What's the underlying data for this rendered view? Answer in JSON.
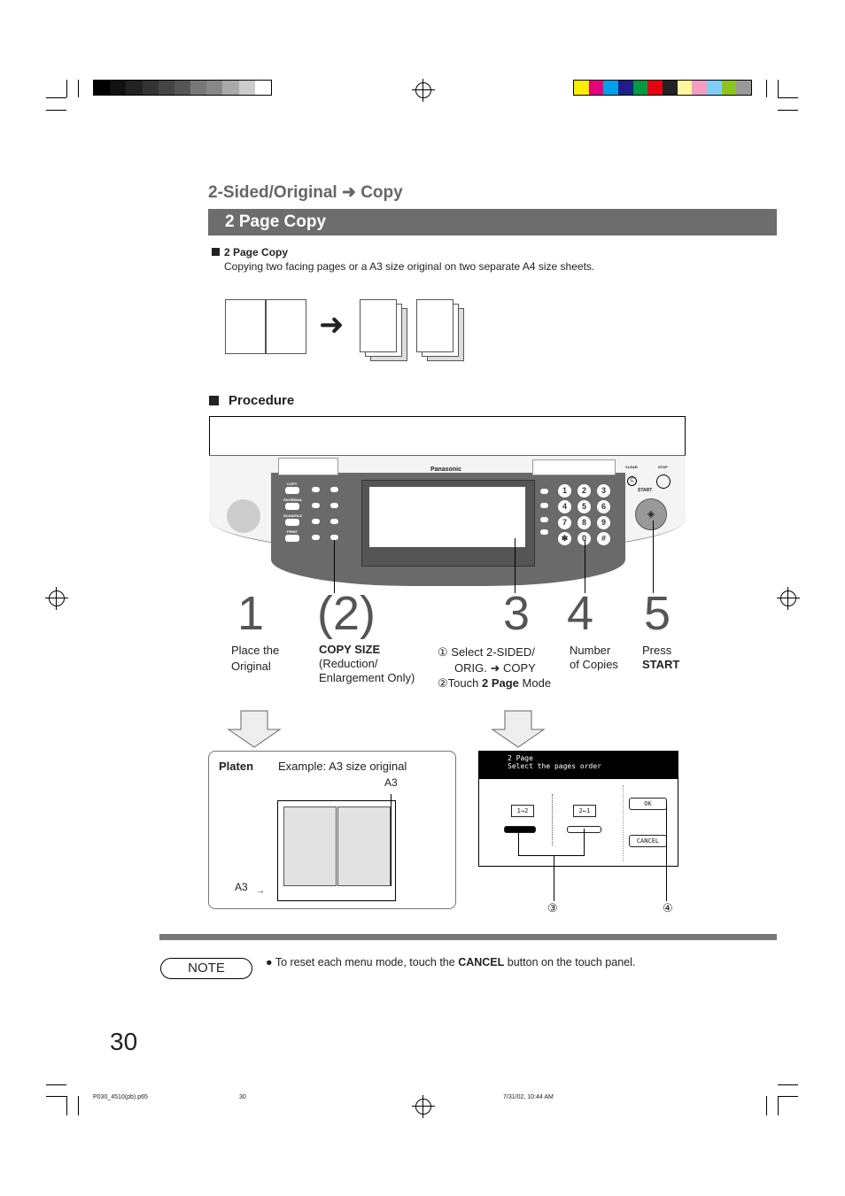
{
  "header": {
    "section_title": "2-Sided/Original",
    "arrow": "➜",
    "section_target": "Copy",
    "banner": "2 Page Copy"
  },
  "intro": {
    "heading": "2 Page Copy",
    "text": "Copying two facing pages or a A3 size original on two separate A4 size sheets."
  },
  "procedure": {
    "heading": "Procedure",
    "panel": {
      "brand": "Panasonic",
      "clear": "CLEAR",
      "stop": "STOP",
      "start": "START",
      "modes": [
        "COPY",
        "FAX/EMAIL",
        "SCAN/FILE",
        "PRINT"
      ],
      "keys": [
        "1",
        "2",
        "3",
        "4",
        "5",
        "6",
        "7",
        "8",
        "9",
        "✱",
        "0",
        "#"
      ]
    },
    "steps": [
      {
        "number": "1",
        "lines": [
          "Place the",
          "Original"
        ]
      },
      {
        "number": "(2)",
        "bold": "COPY SIZE",
        "lines": [
          "(Reduction/",
          "Enlargement Only)"
        ]
      },
      {
        "number": "3",
        "l1_prefix": "①",
        "l1": "Select 2-SIDED/",
        "l2a": "ORIG.",
        "l2b": "COPY",
        "l3_prefix": "②Touch",
        "l3_bold": "2 Page",
        "l3_suffix": "Mode"
      },
      {
        "number": "4",
        "lines": [
          "Number",
          "of Copies"
        ]
      },
      {
        "number": "5",
        "lines": [
          "Press"
        ],
        "bold": "START"
      }
    ]
  },
  "platen": {
    "title": "Platen",
    "example": "Example: A3 size original",
    "a3_top": "A3",
    "a3_left": "A3"
  },
  "touch_screen": {
    "line1": "2 Page",
    "line2": "Select the pages order",
    "opt1": "1→2",
    "opt2": "2←1",
    "ok": "OK",
    "cancel": "CANCEL",
    "callout3": "③",
    "callout4": "④"
  },
  "note": {
    "label": "NOTE",
    "prefix": "To reset each menu mode, touch the",
    "bold": "CANCEL",
    "suffix": "button on the touch panel."
  },
  "page_number": "30",
  "footer": {
    "file": "P030_4510(pb).p65",
    "page": "30",
    "date": "7/31/02, 10:44 AM"
  },
  "colors": {
    "banner": "#6d6d6d",
    "panel": "#6a6a6a",
    "gray_bar": [
      "#000",
      "#111",
      "#222",
      "#333",
      "#444",
      "#555",
      "#777",
      "#888",
      "#aaa",
      "#ccc",
      "#fff"
    ],
    "color_bar": [
      "#ffee00",
      "#e6007e",
      "#00a0e9",
      "#1d2088",
      "#009944",
      "#e60012",
      "#222",
      "#fff799",
      "#f19ec2",
      "#7ecef4",
      "#8fc31f",
      "#999"
    ]
  }
}
